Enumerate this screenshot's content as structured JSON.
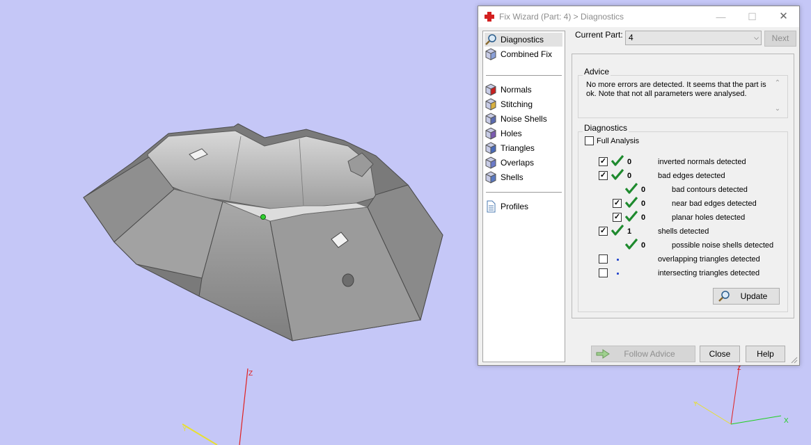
{
  "dialog": {
    "title": "Fix Wizard (Part: 4) > Diagnostics"
  },
  "nav": {
    "items_top": [
      {
        "label": "Diagnostics",
        "icon": "diagnostics-magnifier-icon",
        "selected": true
      },
      {
        "label": "Combined Fix",
        "icon": "combined-fix-icon",
        "selected": false
      }
    ],
    "items_tools": [
      {
        "label": "Normals",
        "icon": "normals-icon"
      },
      {
        "label": "Stitching",
        "icon": "stitching-icon"
      },
      {
        "label": "Noise Shells",
        "icon": "noise-shells-icon"
      },
      {
        "label": "Holes",
        "icon": "holes-icon"
      },
      {
        "label": "Triangles",
        "icon": "triangles-icon"
      },
      {
        "label": "Overlaps",
        "icon": "overlaps-icon"
      },
      {
        "label": "Shells",
        "icon": "shells-icon"
      }
    ],
    "items_bottom": [
      {
        "label": "Profiles",
        "icon": "profiles-document-icon"
      }
    ]
  },
  "current_part": {
    "label": "Current Part:",
    "value": "4",
    "next_label": "Next"
  },
  "advice": {
    "title": "Advice",
    "text": "No more errors are detected. It seems that the part is ok. Note that not all parameters were analysed."
  },
  "diagnostics": {
    "title": "Diagnostics",
    "full_analysis_label": "Full Analysis",
    "full_analysis_checked": false,
    "rows": [
      {
        "checkbox": true,
        "checked": true,
        "status": "ok",
        "count": "0",
        "label": "inverted normals detected",
        "indent": 0
      },
      {
        "checkbox": true,
        "checked": true,
        "status": "ok",
        "count": "0",
        "label": "bad edges detected",
        "indent": 0
      },
      {
        "checkbox": false,
        "checked": false,
        "status": "ok",
        "count": "0",
        "label": "bad contours detected",
        "indent": 1
      },
      {
        "checkbox": true,
        "checked": true,
        "status": "ok",
        "count": "0",
        "label": "near bad edges detected",
        "indent": 1
      },
      {
        "checkbox": true,
        "checked": true,
        "status": "ok",
        "count": "0",
        "label": "planar holes detected",
        "indent": 1
      },
      {
        "checkbox": true,
        "checked": true,
        "status": "ok",
        "count": "1",
        "label": "shells detected",
        "indent": 0
      },
      {
        "checkbox": false,
        "checked": false,
        "status": "ok",
        "count": "0",
        "label": "possible noise shells detected",
        "indent": 1
      },
      {
        "checkbox": true,
        "checked": false,
        "status": "none",
        "count": "",
        "label": "overlapping triangles detected",
        "indent": 0
      },
      {
        "checkbox": true,
        "checked": false,
        "status": "none",
        "count": "",
        "label": "intersecting triangles detected",
        "indent": 0
      }
    ],
    "update_label": "Update"
  },
  "footer": {
    "follow_advice_label": "Follow Advice",
    "close_label": "Close",
    "help_label": "Help"
  },
  "viewport": {
    "background": "#c5c7f7",
    "axes": [
      "Z",
      "X",
      "Y"
    ]
  }
}
